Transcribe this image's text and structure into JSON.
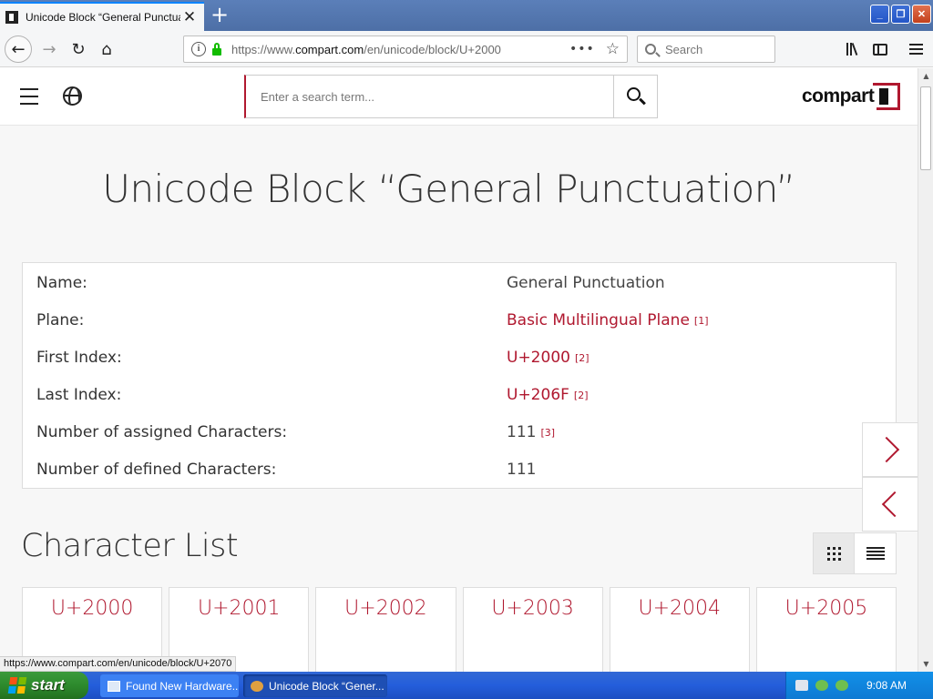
{
  "browser": {
    "tab": {
      "title": "Unicode Block “General Punctuatio",
      "close": "✕"
    },
    "new_tab": "+",
    "window_buttons": {
      "minimize": "_",
      "restore": "❐",
      "close": "✕"
    },
    "nav": {
      "back": "←",
      "forward": "→",
      "reload": "↻",
      "home": "⌂"
    },
    "url": {
      "prefix": "https://www.",
      "domain": "compart.com",
      "path": "/en/unicode/block/U+2000",
      "menu": "•••",
      "bookmark": "☆"
    },
    "search_placeholder": "Search",
    "status_url": "https://www.compart.com/en/unicode/block/U+2070"
  },
  "site": {
    "search_placeholder": "Enter a search term...",
    "logo": "compart",
    "accent": "#b0182f"
  },
  "page": {
    "title": "Unicode Block “General Punctuation”",
    "info": [
      {
        "label": "Name:",
        "value": "General Punctuation",
        "ref": ""
      },
      {
        "label": "Plane:",
        "value": "Basic Multilingual Plane",
        "ref": "[1]"
      },
      {
        "label": "First Index:",
        "value": "U+2000",
        "ref": "[2]"
      },
      {
        "label": "Last Index:",
        "value": "U+206F",
        "ref": "[2]"
      },
      {
        "label": "Number of assigned Characters:",
        "value": "111",
        "ref": "[3]"
      },
      {
        "label": "Number of defined Characters:",
        "value": "111",
        "ref": ""
      }
    ],
    "section_title": "Character List",
    "characters": [
      "U+2000",
      "U+2001",
      "U+2002",
      "U+2003",
      "U+2004",
      "U+2005"
    ]
  },
  "taskbar": {
    "start": "start",
    "items": [
      "Found New Hardware...",
      "Unicode Block “Gener..."
    ],
    "clock": "9:08 AM"
  }
}
